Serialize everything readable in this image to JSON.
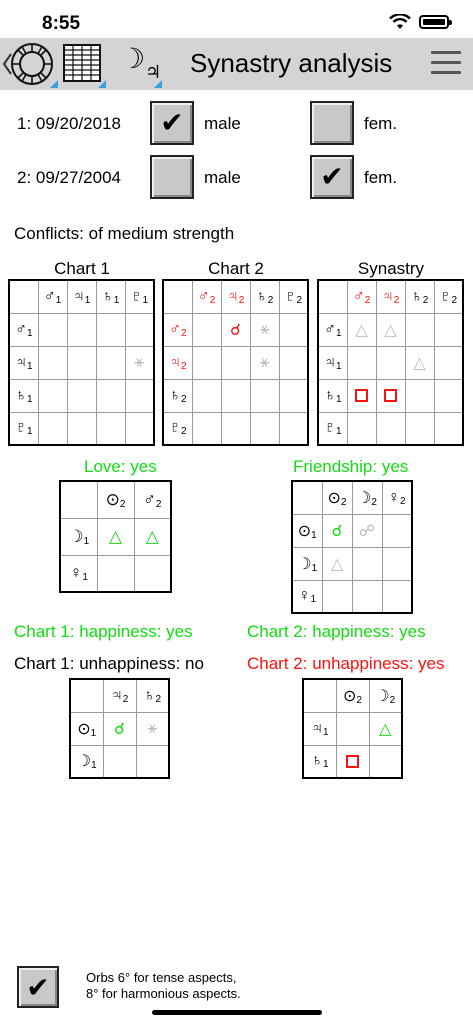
{
  "status": {
    "time": "8:55"
  },
  "toolbar": {
    "title": "Synastry analysis",
    "tools": [
      "wheel-icon",
      "table-icon",
      "moon-jupiter-icon"
    ]
  },
  "persons": [
    {
      "label": "1:  09/20/2018",
      "male_checked": "✔",
      "male": "male",
      "fem_checked": "",
      "fem": "fem."
    },
    {
      "label": "2:  09/27/2004",
      "male_checked": "",
      "male": "male",
      "fem_checked": "✔",
      "fem": "fem."
    }
  ],
  "conflicts": "Conflicts: of medium strength",
  "charts": {
    "chart1": {
      "title": "Chart 1"
    },
    "chart2": {
      "title": "Chart 2"
    },
    "synastry": {
      "title": "Synastry"
    }
  },
  "love": {
    "label": "Love: yes"
  },
  "friendship": {
    "label": "Friendship: yes"
  },
  "happiness1": {
    "label": "Chart 1: happiness: yes"
  },
  "happiness2": {
    "label": "Chart 2: happiness: yes"
  },
  "unhappiness1": {
    "label": "Chart 1: unhappiness: no"
  },
  "unhappiness2": {
    "label": "Chart 2: unhappiness: yes"
  },
  "colors": {
    "positive": "#11dd11",
    "negative": "#ff1111",
    "neutral": "#bbbbbb",
    "toolbar": "#d4d4d4",
    "accent": "#3aa0e0"
  },
  "footer": {
    "checked": "✔",
    "line1": "Orbs 6° for tense aspects,",
    "line2": "8° for harmonious aspects."
  }
}
